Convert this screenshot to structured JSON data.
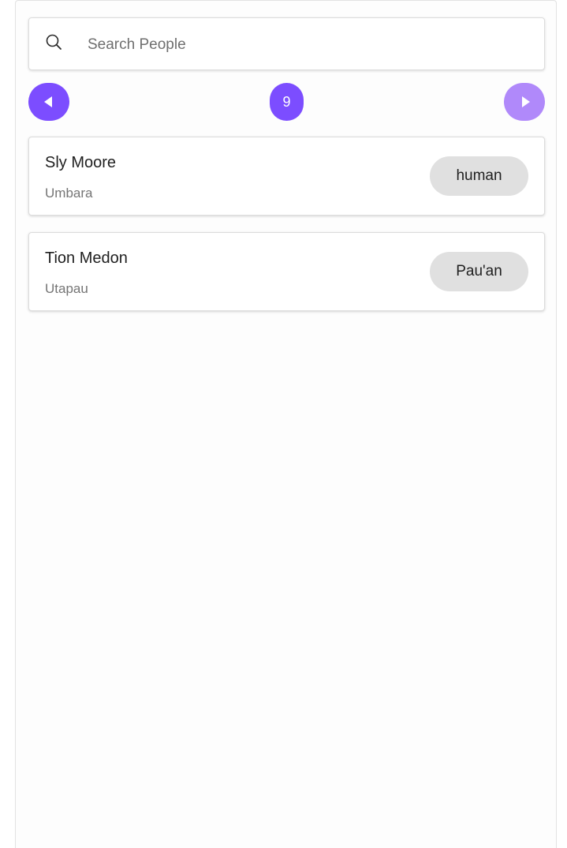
{
  "search": {
    "placeholder": "Search People",
    "value": ""
  },
  "pagination": {
    "current_page": "9",
    "prev_icon": "caret-left-icon",
    "next_icon": "caret-right-icon",
    "next_disabled": true
  },
  "people": [
    {
      "name": "Sly Moore",
      "homeworld": "Umbara",
      "species": "human"
    },
    {
      "name": "Tion Medon",
      "homeworld": "Utapau",
      "species": "Pau'an"
    }
  ],
  "colors": {
    "accent": "#7c4dff",
    "accent_disabled": "#b089fa",
    "chip_background": "#e0e0e0"
  }
}
